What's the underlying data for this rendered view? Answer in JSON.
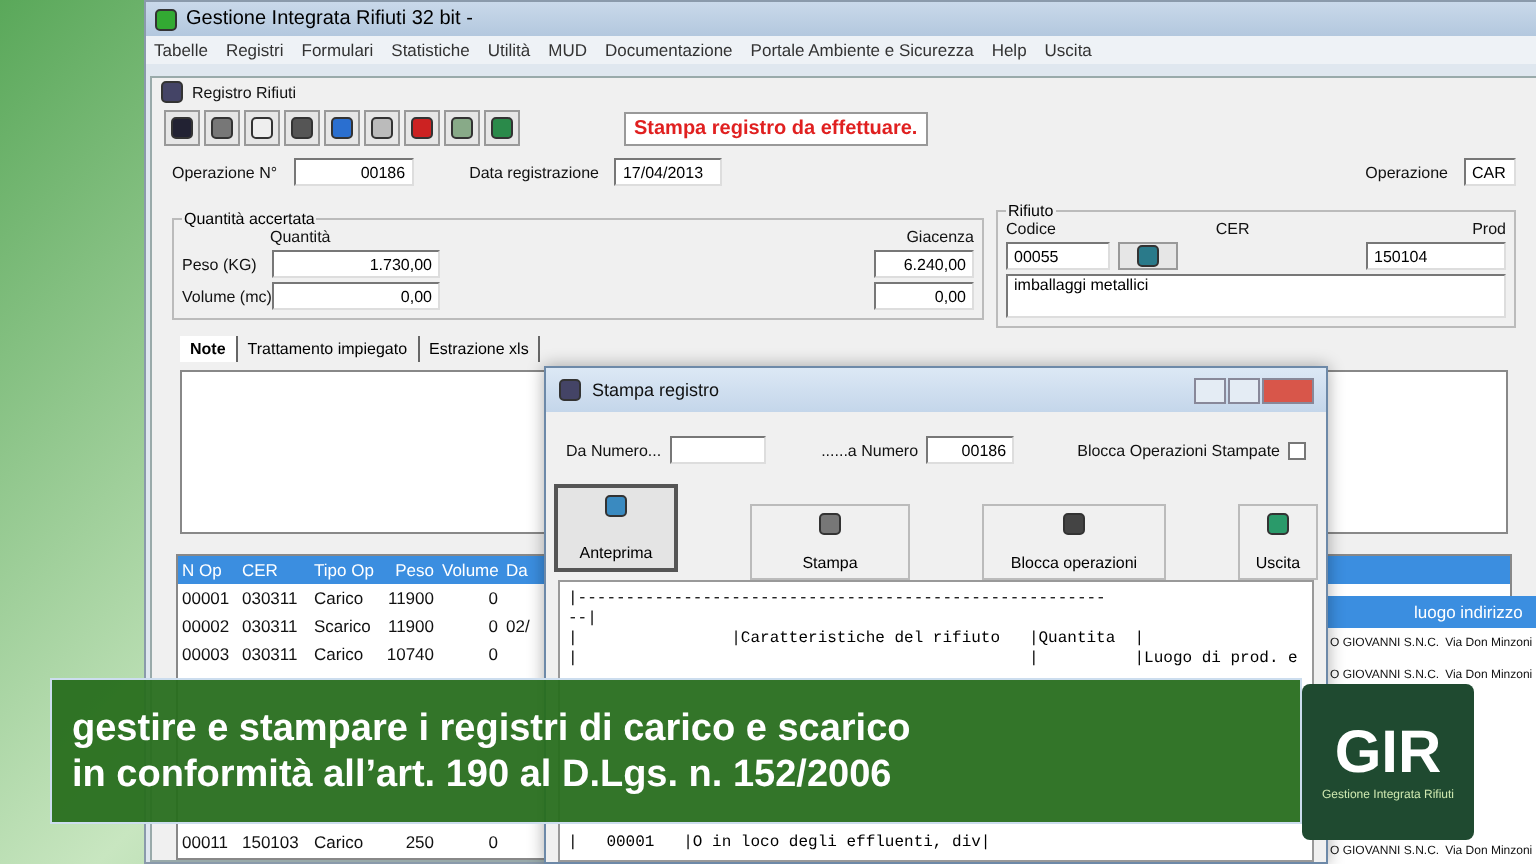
{
  "window": {
    "title": "Gestione Integrata Rifiuti 32 bit -",
    "menu": [
      "Tabelle",
      "Registri",
      "Formulari",
      "Statistiche",
      "Utilità",
      "MUD",
      "Documentazione",
      "Portale Ambiente e Sicurezza",
      "Help",
      "Uscita"
    ]
  },
  "child": {
    "title": "Registro Rifiuti",
    "notice": "Stampa registro da effettuare."
  },
  "operazione": {
    "label": "Operazione N°",
    "value": "00186",
    "date_label": "Data registrazione",
    "date": "17/04/2013"
  },
  "side": {
    "label": "Operazione",
    "value": "CAR",
    "label_2": "Prod"
  },
  "quantita": {
    "title": "Quantità accertata",
    "column": "Quantità",
    "peso_label": "Peso (KG)",
    "peso": "1.730,00",
    "volume_label": "Volume (mc)",
    "volume": "0,00",
    "giacenza_label": "Giacenza",
    "giacenza": "6.240,00",
    "giacenza_2": "0,00"
  },
  "rifiuto": {
    "title": "Rifiuto",
    "codice_label": "Codice",
    "codice": "00055",
    "cer_label": "CER",
    "cer": "150104",
    "description": "imballaggi metallici"
  },
  "tabs": [
    {
      "label": "Note",
      "selected": true
    },
    {
      "label": "Trattamento impiegato",
      "selected": false
    },
    {
      "label": "Estrazione xls",
      "selected": false
    }
  ],
  "table": {
    "columns": [
      "N Op",
      "CER",
      "Tipo Op",
      "Peso",
      "Volume",
      "Da"
    ],
    "rows": [
      [
        "00001",
        "030311",
        "Carico",
        "11900",
        "0"
      ],
      [
        "00002",
        "030311",
        "Scarico",
        "11900",
        "0",
        "02/"
      ],
      [
        "00003",
        "030311",
        "Carico",
        "10740",
        "0"
      ]
    ],
    "last_row": [
      "00011",
      "150103",
      "Carico",
      "250",
      "0"
    ]
  },
  "side_table": {
    "column": "luogo indirizzo",
    "rows": [
      [
        "O GIOVANNI S.N.C.",
        "Via Don Minzoni"
      ],
      [
        "O GIOVANNI S.N.C.",
        "Via Don Minzoni"
      ]
    ],
    "last_row": [
      "O GIOVANNI S.N.C.",
      "Via Don Minzoni"
    ]
  },
  "dialog": {
    "title": "Stampa registro",
    "from_label": "Da Numero...",
    "to_label": "......a Numero",
    "to_value": "00186",
    "lock": {
      "label": "Blocca Operazioni Stampate",
      "checked": false
    },
    "buttons": [
      {
        "kind": "preview",
        "label": "Anteprima",
        "selected": true
      },
      {
        "kind": "print",
        "label": "Stampa",
        "selected": false
      },
      {
        "kind": "lock",
        "label": "Blocca operazioni",
        "selected": false
      },
      {
        "kind": "exit",
        "label": "Uscita",
        "selected": false
      }
    ],
    "preview": [
      "|-------------------------------------------------------",
      "--|",
      "|                |Caratteristiche del rifiuto   |Quantita  |",
      "|                                               |          |Luogo di prod. e"
    ],
    "preview_last_line": "|   00001   |O in loco degli effluenti, div|"
  },
  "banner": [
    "gestire e stampare i registri di carico e scarico",
    "in conformità all’art. 190 al D.Lgs. n. 152/2006"
  ],
  "logo": {
    "mark": "GIR",
    "subtitle": "Gestione Integrata Rifiuti"
  }
}
